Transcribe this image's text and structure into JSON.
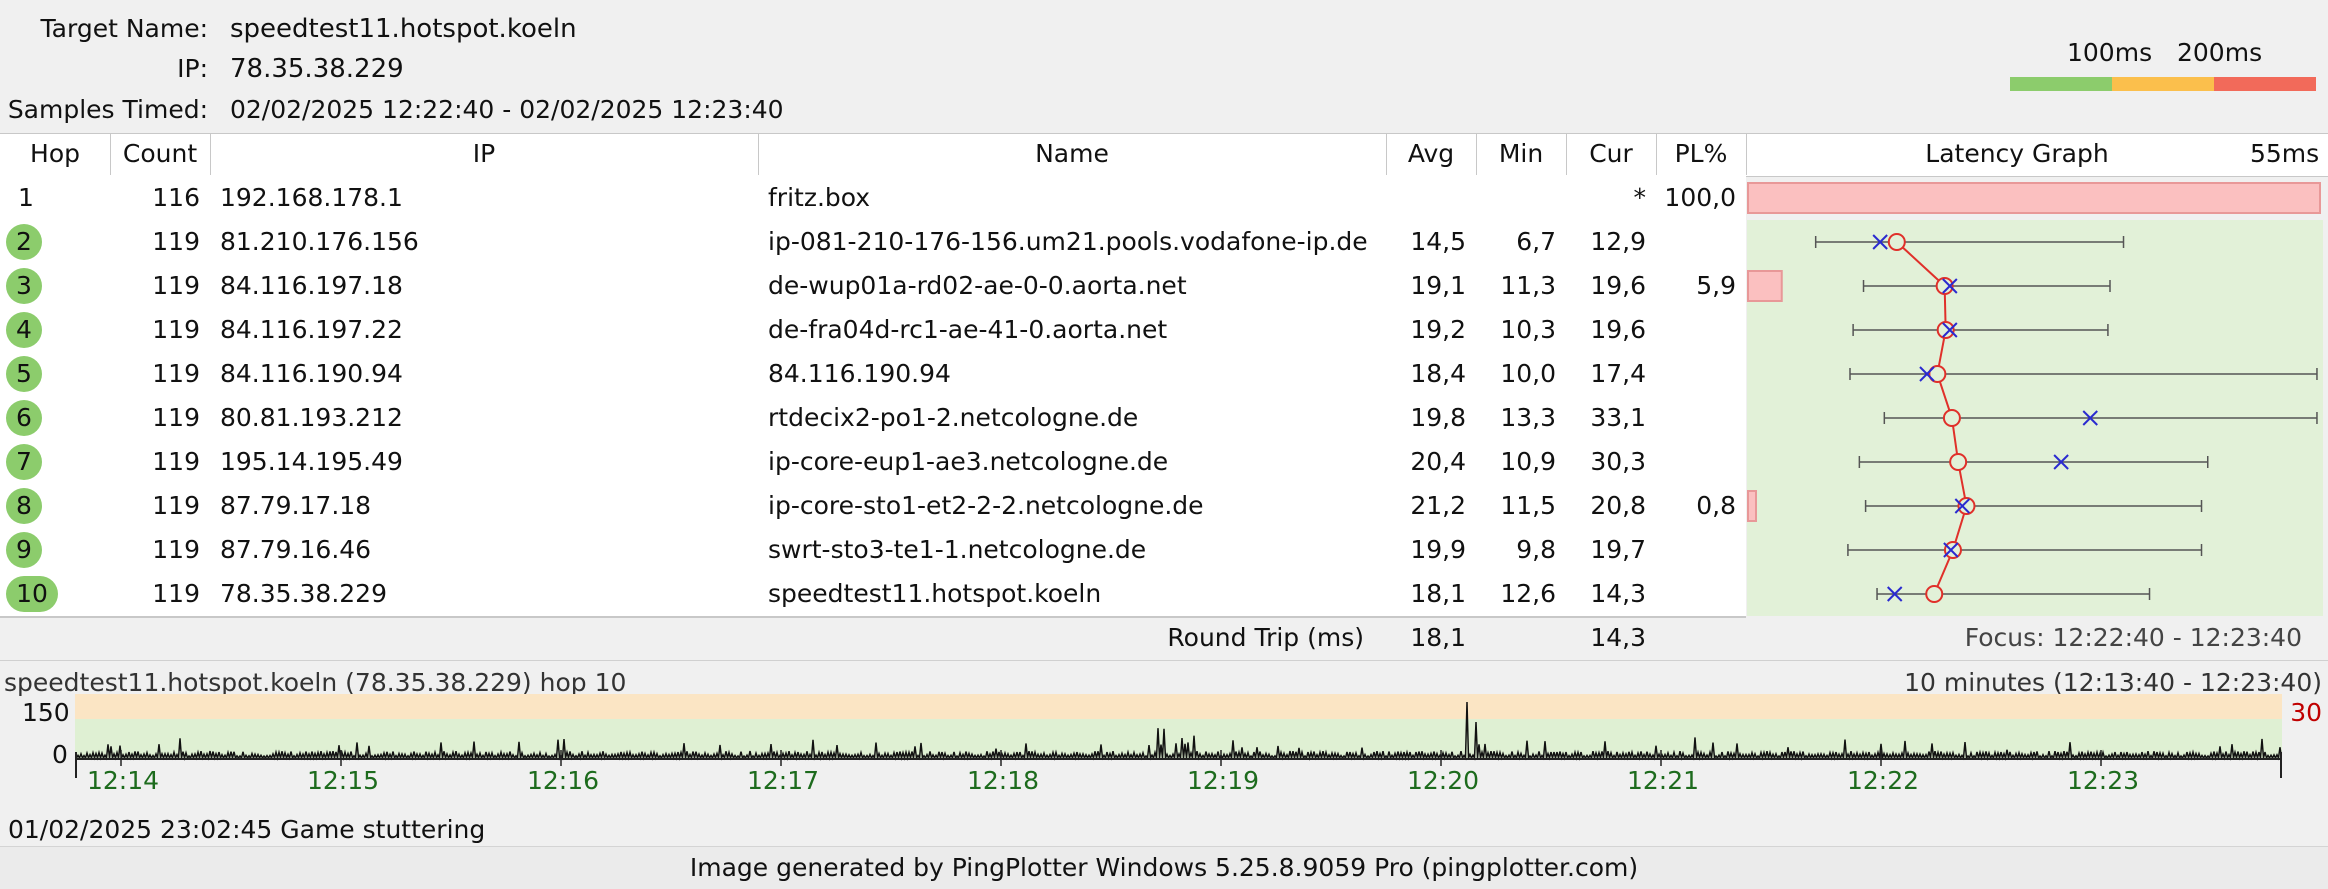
{
  "header": {
    "target_label": "Target Name:",
    "target_value": "speedtest11.hotspot.koeln",
    "ip_label": "IP:",
    "ip_value": "78.35.38.229",
    "samples_label": "Samples Timed:",
    "samples_value": "02/02/2025 12:22:40 - 02/02/2025 12:23:40",
    "scale_100": "100ms",
    "scale_200": "200ms",
    "scale_colors": [
      "#8ccc6c",
      "#fbbf4c",
      "#f26a5a"
    ]
  },
  "columns": {
    "hop": "Hop",
    "count": "Count",
    "ip": "IP",
    "name": "Name",
    "avg": "Avg",
    "min": "Min",
    "cur": "Cur",
    "pl": "PL%",
    "graph": "Latency Graph",
    "graph_scale": "55ms"
  },
  "hops": [
    {
      "hop": "1",
      "count": "116",
      "ip": "192.168.178.1",
      "name": "fritz.box",
      "avg": "",
      "min": "",
      "cur": "*",
      "pl": "100,0",
      "pl_value": 100,
      "badge": false,
      "min_ms": null,
      "avg_ms": null,
      "max_ms": null,
      "cur_ms": null
    },
    {
      "hop": "2",
      "count": "119",
      "ip": "81.210.176.156",
      "name": "ip-081-210-176-156.um21.pools.vodafone-ip.de",
      "avg": "14,5",
      "min": "6,7",
      "cur": "12,9",
      "pl": "",
      "pl_value": 0,
      "badge": true,
      "min_ms": 6.7,
      "avg_ms": 14.5,
      "max_ms": 36.3,
      "cur_ms": 12.9
    },
    {
      "hop": "3",
      "count": "119",
      "ip": "84.116.197.18",
      "name": "de-wup01a-rd02-ae-0-0.aorta.net",
      "avg": "19,1",
      "min": "11,3",
      "cur": "19,6",
      "pl": "5,9",
      "pl_value": 5.9,
      "badge": true,
      "min_ms": 11.3,
      "avg_ms": 19.1,
      "max_ms": 35.0,
      "cur_ms": 19.6
    },
    {
      "hop": "4",
      "count": "119",
      "ip": "84.116.197.22",
      "name": "de-fra04d-rc1-ae-41-0.aorta.net",
      "avg": "19,2",
      "min": "10,3",
      "cur": "19,6",
      "pl": "",
      "pl_value": 0,
      "badge": true,
      "min_ms": 10.3,
      "avg_ms": 19.2,
      "max_ms": 34.8,
      "cur_ms": 19.6
    },
    {
      "hop": "5",
      "count": "119",
      "ip": "84.116.190.94",
      "name": "84.116.190.94",
      "avg": "18,4",
      "min": "10,0",
      "cur": "17,4",
      "pl": "",
      "pl_value": 0,
      "badge": true,
      "min_ms": 10.0,
      "avg_ms": 18.4,
      "max_ms": 54.9,
      "cur_ms": 17.4
    },
    {
      "hop": "6",
      "count": "119",
      "ip": "80.81.193.212",
      "name": "rtdecix2-po1-2.netcologne.de",
      "avg": "19,8",
      "min": "13,3",
      "cur": "33,1",
      "pl": "",
      "pl_value": 0,
      "badge": true,
      "min_ms": 13.3,
      "avg_ms": 19.8,
      "max_ms": 54.9,
      "cur_ms": 33.1
    },
    {
      "hop": "7",
      "count": "119",
      "ip": "195.14.195.49",
      "name": "ip-core-eup1-ae3.netcologne.de",
      "avg": "20,4",
      "min": "10,9",
      "cur": "30,3",
      "pl": "",
      "pl_value": 0,
      "badge": true,
      "min_ms": 10.9,
      "avg_ms": 20.4,
      "max_ms": 44.4,
      "cur_ms": 30.3
    },
    {
      "hop": "8",
      "count": "119",
      "ip": "87.79.17.18",
      "name": "ip-core-sto1-et2-2-2.netcologne.de",
      "avg": "21,2",
      "min": "11,5",
      "cur": "20,8",
      "pl": "0,8",
      "pl_value": 0.8,
      "badge": true,
      "min_ms": 11.5,
      "avg_ms": 21.2,
      "max_ms": 43.8,
      "cur_ms": 20.8
    },
    {
      "hop": "9",
      "count": "119",
      "ip": "87.79.16.46",
      "name": "swrt-sto3-te1-1.netcologne.de",
      "avg": "19,9",
      "min": "9,8",
      "cur": "19,7",
      "pl": "",
      "pl_value": 0,
      "badge": true,
      "min_ms": 9.8,
      "avg_ms": 19.9,
      "max_ms": 43.8,
      "cur_ms": 19.7
    },
    {
      "hop": "10",
      "count": "119",
      "ip": "78.35.38.229",
      "name": "speedtest11.hotspot.koeln",
      "avg": "18,1",
      "min": "12,6",
      "cur": "14,3",
      "pl": "",
      "pl_value": 0,
      "badge": true,
      "min_ms": 12.6,
      "avg_ms": 18.1,
      "max_ms": 38.8,
      "cur_ms": 14.3
    }
  ],
  "round_trip": {
    "label": "Round Trip (ms)",
    "avg": "18,1",
    "cur": "14,3",
    "focus": "Focus: 12:22:40 - 12:23:40"
  },
  "timeline": {
    "title": "speedtest11.hotspot.koeln (78.35.38.229) hop 10",
    "range": "10 minutes (12:13:40 - 12:23:40)",
    "y_top": "150",
    "y_zero": "0",
    "max_label": "30",
    "ticks": [
      "12:14",
      "12:15",
      "12:16",
      "12:17",
      "12:18",
      "12:19",
      "12:20",
      "12:21",
      "12:22",
      "12:23"
    ]
  },
  "status_note": "01/02/2025 23:02:45 Game stuttering",
  "footer": "Image generated by PingPlotter Windows 5.25.8.9059 Pro (pingplotter.com)"
}
